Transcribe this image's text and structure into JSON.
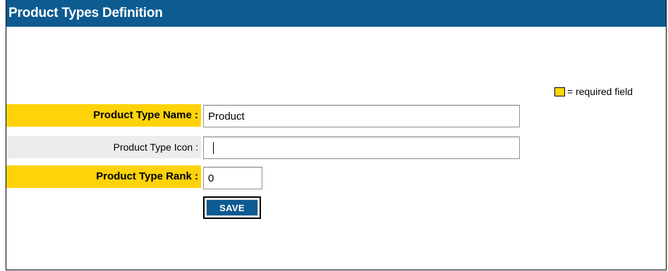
{
  "header": {
    "title": "Product Types Definition"
  },
  "legend": {
    "text": "= required field",
    "swatch_color": "#ffd700"
  },
  "form": {
    "fields": [
      {
        "label": "Product Type Name :",
        "value": "Product",
        "required": true
      },
      {
        "label": "Product Type Icon :",
        "value": "",
        "required": false,
        "focused": true
      },
      {
        "label": "Product Type Rank :",
        "value": "0",
        "required": true
      }
    ],
    "save_label": "SAVE"
  },
  "colors": {
    "header_bg": "#0d5b91",
    "required_label_bg": "#ffd30a",
    "optional_label_bg": "#ececec",
    "button_bg": "#0d5b91"
  }
}
